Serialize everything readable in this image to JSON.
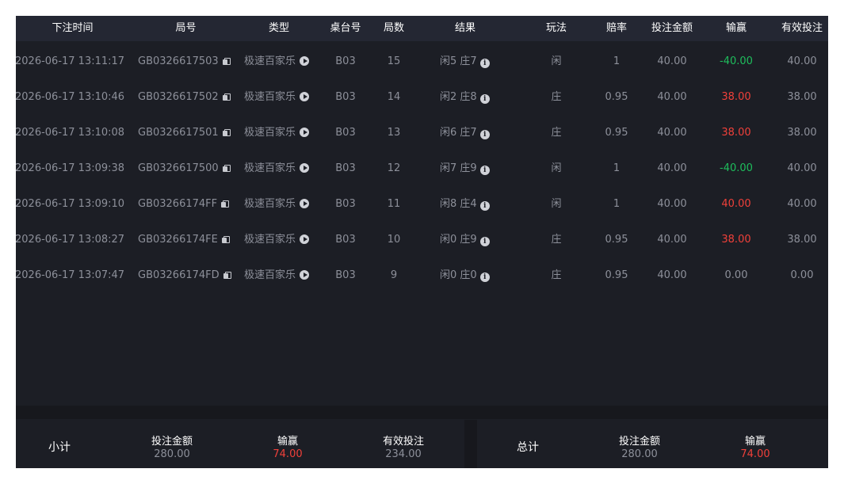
{
  "table": {
    "headers": [
      "下注时间",
      "局号",
      "类型",
      "桌台号",
      "局数",
      "结果",
      "玩法",
      "赔率",
      "投注金额",
      "输赢",
      "有效投注"
    ],
    "rows": [
      {
        "time": "2026-06-17 13:11:17",
        "round_id": "GB0326617503",
        "type": "极速百家乐",
        "table": "B03",
        "round": "15",
        "result": "闲5 庄7",
        "play": "闲",
        "odds": "1",
        "bet": "40.00",
        "win": "-40.00",
        "win_sign": "neg",
        "valid": "40.00"
      },
      {
        "time": "2026-06-17 13:10:46",
        "round_id": "GB0326617502",
        "type": "极速百家乐",
        "table": "B03",
        "round": "14",
        "result": "闲2 庄8",
        "play": "庄",
        "odds": "0.95",
        "bet": "40.00",
        "win": "38.00",
        "win_sign": "pos",
        "valid": "38.00"
      },
      {
        "time": "2026-06-17 13:10:08",
        "round_id": "GB0326617501",
        "type": "极速百家乐",
        "table": "B03",
        "round": "13",
        "result": "闲6 庄7",
        "play": "庄",
        "odds": "0.95",
        "bet": "40.00",
        "win": "38.00",
        "win_sign": "pos",
        "valid": "38.00"
      },
      {
        "time": "2026-06-17 13:09:38",
        "round_id": "GB0326617500",
        "type": "极速百家乐",
        "table": "B03",
        "round": "12",
        "result": "闲7 庄9",
        "play": "闲",
        "odds": "1",
        "bet": "40.00",
        "win": "-40.00",
        "win_sign": "neg",
        "valid": "40.00"
      },
      {
        "time": "2026-06-17 13:09:10",
        "round_id": "GB03266174FF",
        "type": "极速百家乐",
        "table": "B03",
        "round": "11",
        "result": "闲8 庄4",
        "play": "闲",
        "odds": "1",
        "bet": "40.00",
        "win": "40.00",
        "win_sign": "pos",
        "valid": "40.00"
      },
      {
        "time": "2026-06-17 13:08:27",
        "round_id": "GB03266174FE",
        "type": "极速百家乐",
        "table": "B03",
        "round": "10",
        "result": "闲0 庄9",
        "play": "庄",
        "odds": "0.95",
        "bet": "40.00",
        "win": "38.00",
        "win_sign": "pos",
        "valid": "38.00"
      },
      {
        "time": "2026-06-17 13:07:47",
        "round_id": "GB03266174FD",
        "type": "极速百家乐",
        "table": "B03",
        "round": "9",
        "result": "闲0 庄0",
        "play": "庄",
        "odds": "0.95",
        "bet": "40.00",
        "win": "0.00",
        "win_sign": "zero",
        "valid": "0.00"
      }
    ]
  },
  "subtotal": {
    "title": "小计",
    "bet_label": "投注金额",
    "bet_value": "280.00",
    "win_label": "输赢",
    "win_value": "74.00",
    "valid_label": "有效投注",
    "valid_value": "234.00"
  },
  "total": {
    "title": "总计",
    "bet_label": "投注金额",
    "bet_value": "280.00",
    "win_label": "输赢",
    "win_value": "74.00"
  },
  "colors": {
    "negative": "#1ebd5c",
    "positive": "#f0403a",
    "header_bg": "#242733",
    "panel_bg": "#1c1e25"
  },
  "icons": {
    "round_id": "copy-icon",
    "type": "play-icon",
    "result": "info-icon"
  }
}
